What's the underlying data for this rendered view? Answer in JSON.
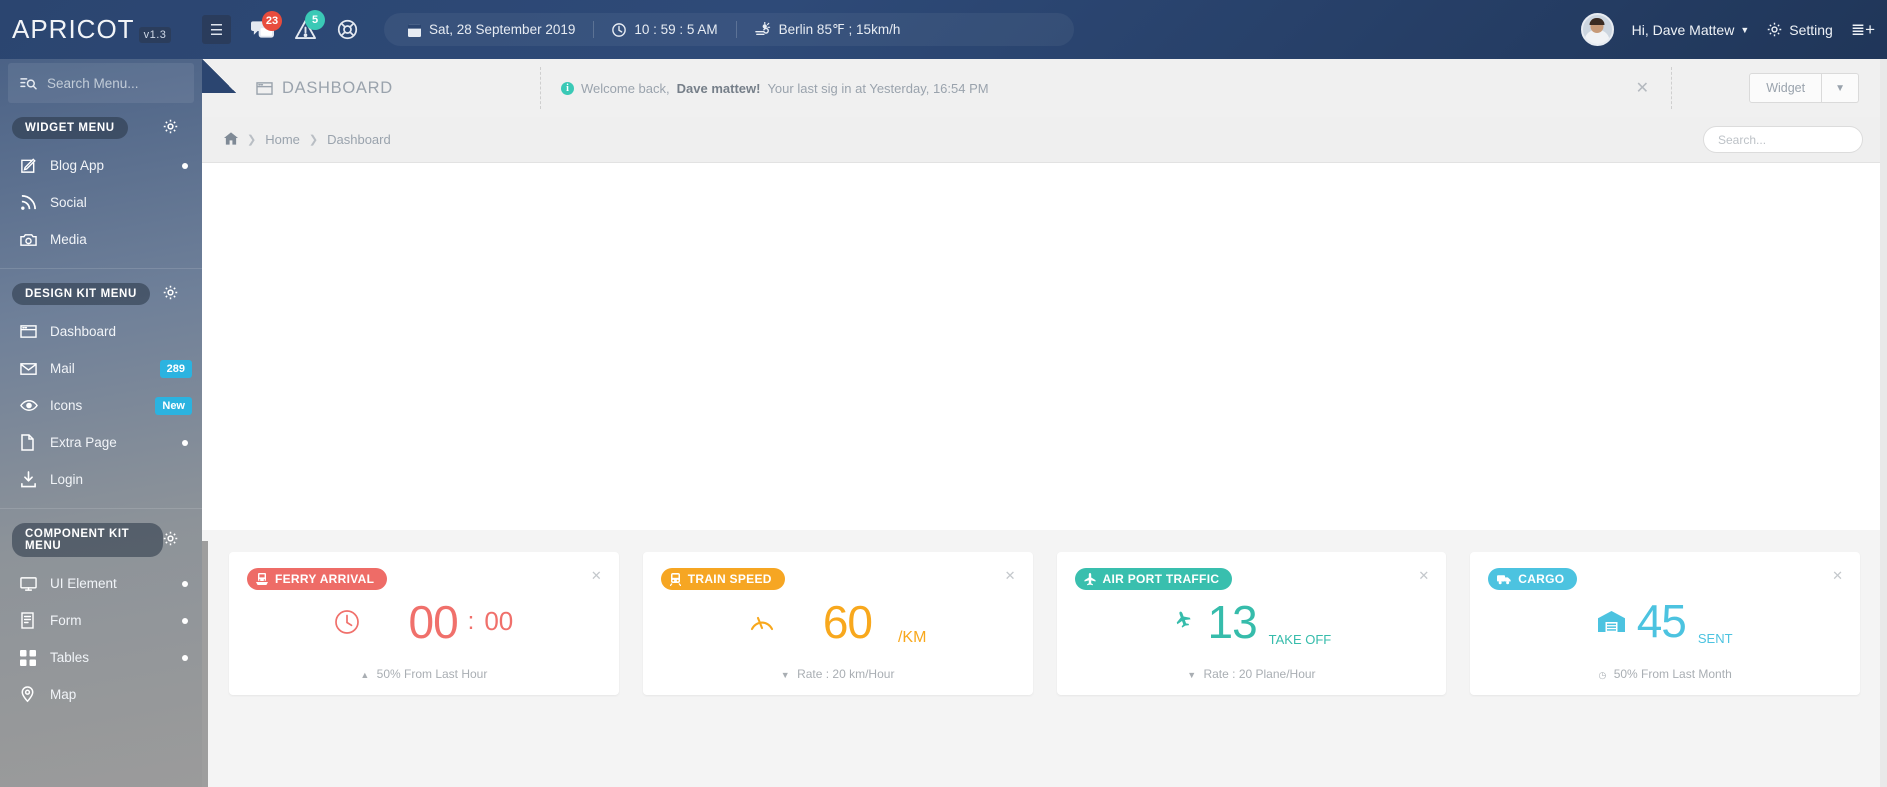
{
  "header": {
    "brand_name": "APRICOT",
    "brand_version": "v1.3",
    "menu_icon": "hamburger-icon",
    "messages_badge": "23",
    "alerts_badge": "5",
    "lifebuoy_icon": "support-icon",
    "date": "Sat, 28 September 2019",
    "time": "10 : 59 : 5 AM",
    "weather": "Berlin  85℉ ; 15km/h",
    "user_greeting": "Hi, Dave Mattew",
    "setting_label": "Setting",
    "more_icon": "list-add-icon"
  },
  "sidebar": {
    "search_placeholder": "Search Menu...",
    "sections": [
      {
        "title": "WIDGET MENU",
        "items": [
          {
            "label": "Blog App",
            "icon": "pencil-square-icon",
            "marker": "dot"
          },
          {
            "label": "Social",
            "icon": "rss-icon",
            "marker": "none"
          },
          {
            "label": "Media",
            "icon": "camera-icon",
            "marker": "none"
          }
        ]
      },
      {
        "title": "DESIGN KIT MENU",
        "items": [
          {
            "label": "Dashboard",
            "icon": "window-icon",
            "marker": "none"
          },
          {
            "label": "Mail",
            "icon": "envelope-icon",
            "marker": "badge",
            "badge": "289"
          },
          {
            "label": "Icons",
            "icon": "eye-icon",
            "marker": "badge",
            "badge": "New"
          },
          {
            "label": "Extra Page",
            "icon": "file-icon",
            "marker": "dot"
          },
          {
            "label": "Login",
            "icon": "download-icon",
            "marker": "none"
          }
        ]
      },
      {
        "title": "COMPONENT KIT MENU",
        "items": [
          {
            "label": "UI Element",
            "icon": "monitor-icon",
            "marker": "dot"
          },
          {
            "label": "Form",
            "icon": "form-icon",
            "marker": "dot"
          },
          {
            "label": "Tables",
            "icon": "grid-icon",
            "marker": "dot"
          },
          {
            "label": "Map",
            "icon": "map-pin-icon",
            "marker": "none"
          }
        ]
      }
    ]
  },
  "content": {
    "page_title": "DASHBOARD",
    "welcome_prefix": "Welcome back,",
    "welcome_user": "Dave mattew!",
    "welcome_suffix": "Your last sig in at Yesterday, 16:54 PM",
    "widget_button": "Widget",
    "breadcrumb": {
      "home": "Home",
      "current": "Dashboard"
    },
    "search_placeholder": "Search..."
  },
  "cards": [
    {
      "title": "FERRY ARRIVAL",
      "icon": "ferry-icon",
      "color": "#ee6c67",
      "accent_class": "red",
      "body_icon": "clock-icon",
      "value": "00",
      "separator": ":",
      "value_small": "00",
      "unit": "",
      "footer_arrow": "▲",
      "footer": "50%  From Last Hour"
    },
    {
      "title": "TRAIN SPEED",
      "icon": "train-icon",
      "color": "#f6a623",
      "accent_class": "org",
      "body_icon": "gauge-icon",
      "value": "60",
      "separator": "",
      "value_small": "",
      "unit": "/KM",
      "footer_arrow": "▼",
      "footer": "Rate : 20 km/Hour"
    },
    {
      "title": "AIR PORT TRAFFIC",
      "icon": "plane-icon",
      "color": "#39bfae",
      "accent_class": "teal",
      "body_icon": "plane-takeoff-icon",
      "value": "13",
      "separator": "",
      "value_small": "",
      "unit": "TAKE OFF",
      "footer_arrow": "▼",
      "footer": "Rate : 20 Plane/Hour"
    },
    {
      "title": "CARGO",
      "icon": "truck-icon",
      "color": "#4cc3e0",
      "accent_class": "blue",
      "body_icon": "warehouse-icon",
      "value": "45",
      "separator": "",
      "value_small": "",
      "unit": "SENT",
      "footer_arrow": "◷",
      "footer": "50% From Last Month"
    }
  ]
}
